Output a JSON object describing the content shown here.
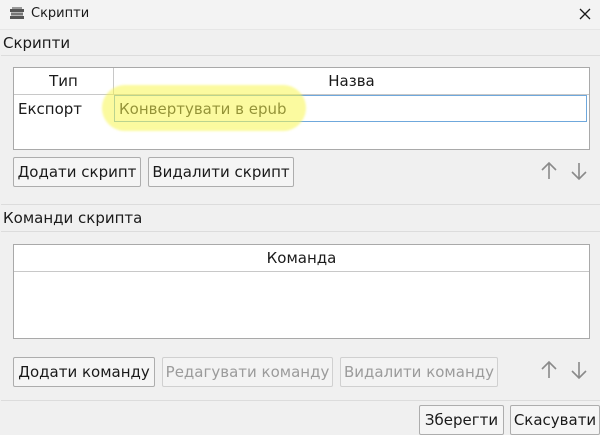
{
  "window": {
    "title": "Скрипти",
    "icon": "books-icon",
    "close_icon": "close-icon"
  },
  "scripts_section": {
    "label": "Скрипти",
    "columns": [
      "Тип",
      "Назва"
    ],
    "rows": [
      {
        "type": "Експорт",
        "name": "Конвертувати в epub"
      }
    ],
    "add_button": "Додати скрипт",
    "remove_button": "Видалити скрипт",
    "move_up_icon": "arrow-up-icon",
    "move_down_icon": "arrow-down-icon"
  },
  "commands_section": {
    "label": "Команди скрипта",
    "columns": [
      "Команда"
    ],
    "rows": [],
    "add_button": "Додати команду",
    "edit_button": "Редагувати команду",
    "remove_button": "Видалити команду",
    "move_up_icon": "arrow-up-icon",
    "move_down_icon": "arrow-down-icon"
  },
  "footer": {
    "save_button": "Зберегти",
    "cancel_button": "Скасувати"
  },
  "colors": {
    "highlight": "#f8f650",
    "focus_border": "#6fa8dc",
    "disabled_text": "#9b9b9b"
  }
}
